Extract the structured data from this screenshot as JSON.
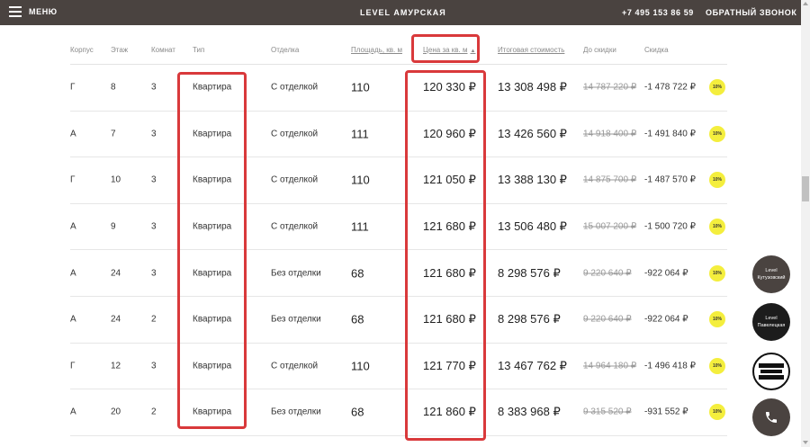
{
  "header": {
    "menu_label": "МЕНЮ",
    "brand": "LEVEL АМУРСКАЯ",
    "phone": "+7 495 153 86 59",
    "callback_label": "ОБРАТНЫЙ ЗВОНОК"
  },
  "table": {
    "headers": {
      "building": "Корпус",
      "floor": "Этаж",
      "rooms": "Комнат",
      "type": "Тип",
      "finish": "Отделка",
      "area": "Площадь, кв. м",
      "price_sqm": "Цена за кв. м",
      "total": "Итоговая стоимость",
      "before_discount": "До скидки",
      "discount": "Скидка"
    },
    "sort_indicator": "▲",
    "rows": [
      {
        "building": "Г",
        "floor": "8",
        "rooms": "3",
        "type": "Квартира",
        "finish": "С отделкой",
        "area": "110",
        "price_sqm": "120 330 ₽",
        "total": "13 308 498 ₽",
        "before_discount": "14 787 220 ₽",
        "discount": "-1 478 722 ₽",
        "badge": "10%"
      },
      {
        "building": "А",
        "floor": "7",
        "rooms": "3",
        "type": "Квартира",
        "finish": "С отделкой",
        "area": "111",
        "price_sqm": "120 960 ₽",
        "total": "13 426 560 ₽",
        "before_discount": "14 918 400 ₽",
        "discount": "-1 491 840 ₽",
        "badge": "10%"
      },
      {
        "building": "Г",
        "floor": "10",
        "rooms": "3",
        "type": "Квартира",
        "finish": "С отделкой",
        "area": "110",
        "price_sqm": "121 050 ₽",
        "total": "13 388 130 ₽",
        "before_discount": "14 875 700 ₽",
        "discount": "-1 487 570 ₽",
        "badge": "10%"
      },
      {
        "building": "А",
        "floor": "9",
        "rooms": "3",
        "type": "Квартира",
        "finish": "С отделкой",
        "area": "111",
        "price_sqm": "121 680 ₽",
        "total": "13 506 480 ₽",
        "before_discount": "15 007 200 ₽",
        "discount": "-1 500 720 ₽",
        "badge": "10%"
      },
      {
        "building": "А",
        "floor": "24",
        "rooms": "3",
        "type": "Квартира",
        "finish": "Без отделки",
        "area": "68",
        "price_sqm": "121 680 ₽",
        "total": "8 298 576 ₽",
        "before_discount": "9 220 640 ₽",
        "discount": "-922 064 ₽",
        "badge": "10%"
      },
      {
        "building": "А",
        "floor": "24",
        "rooms": "2",
        "type": "Квартира",
        "finish": "Без отделки",
        "area": "68",
        "price_sqm": "121 680 ₽",
        "total": "8 298 576 ₽",
        "before_discount": "9 220 640 ₽",
        "discount": "-922 064 ₽",
        "badge": "10%"
      },
      {
        "building": "Г",
        "floor": "12",
        "rooms": "3",
        "type": "Квартира",
        "finish": "С отделкой",
        "area": "110",
        "price_sqm": "121 770 ₽",
        "total": "13 467 762 ₽",
        "before_discount": "14 964 180 ₽",
        "discount": "-1 496 418 ₽",
        "badge": "10%"
      },
      {
        "building": "А",
        "floor": "20",
        "rooms": "2",
        "type": "Квартира",
        "finish": "Без отделки",
        "area": "68",
        "price_sqm": "121 860 ₽",
        "total": "8 383 968 ₽",
        "before_discount": "9 315 520 ₽",
        "discount": "-931 552 ₽",
        "badge": "10%"
      }
    ]
  },
  "side_buttons": {
    "kutuzovsky": {
      "line1": "Level",
      "line2": "Кутузовский"
    },
    "paveletskaya": {
      "line1": "Level",
      "line2": "Павелецкая"
    },
    "call_icon": "phone-icon"
  },
  "colors": {
    "header_bg": "#4a4340",
    "badge": "#f4ee3d",
    "highlight": "#d9393b"
  }
}
